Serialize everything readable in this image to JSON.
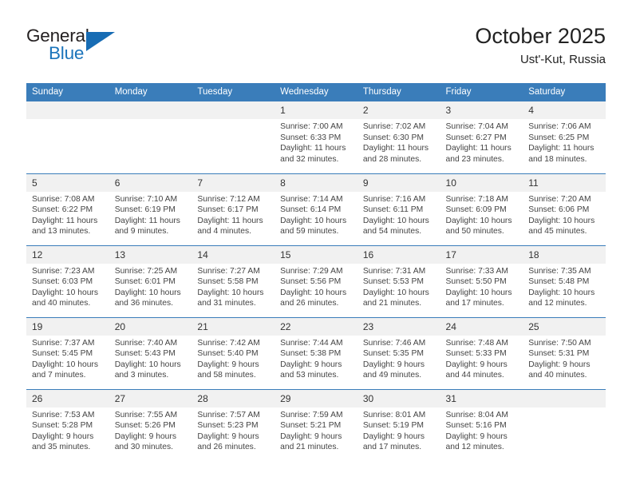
{
  "brand": {
    "word_one": "General",
    "word_two": "Blue",
    "triangle_icon": "blue-triangle-logo-mark",
    "accent_color": "#176cb4"
  },
  "header": {
    "title": "October 2025",
    "subtitle": "Ust'-Kut, Russia"
  },
  "calendar": {
    "header_color": "#3a7dba",
    "daynum_band_color": "#f1f1f1",
    "weekday_headers": [
      "Sunday",
      "Monday",
      "Tuesday",
      "Wednesday",
      "Thursday",
      "Friday",
      "Saturday"
    ],
    "labels": {
      "sunrise": "Sunrise:",
      "sunset": "Sunset:",
      "daylight": "Daylight:"
    },
    "weeks": [
      [
        {
          "day": "",
          "empty": true
        },
        {
          "day": "",
          "empty": true
        },
        {
          "day": "",
          "empty": true
        },
        {
          "day": "1",
          "sunrise": "Sunrise: 7:00 AM",
          "sunset": "Sunset: 6:33 PM",
          "daylight_1": "Daylight: 11 hours",
          "daylight_2": "and 32 minutes."
        },
        {
          "day": "2",
          "sunrise": "Sunrise: 7:02 AM",
          "sunset": "Sunset: 6:30 PM",
          "daylight_1": "Daylight: 11 hours",
          "daylight_2": "and 28 minutes."
        },
        {
          "day": "3",
          "sunrise": "Sunrise: 7:04 AM",
          "sunset": "Sunset: 6:27 PM",
          "daylight_1": "Daylight: 11 hours",
          "daylight_2": "and 23 minutes."
        },
        {
          "day": "4",
          "sunrise": "Sunrise: 7:06 AM",
          "sunset": "Sunset: 6:25 PM",
          "daylight_1": "Daylight: 11 hours",
          "daylight_2": "and 18 minutes."
        }
      ],
      [
        {
          "day": "5",
          "sunrise": "Sunrise: 7:08 AM",
          "sunset": "Sunset: 6:22 PM",
          "daylight_1": "Daylight: 11 hours",
          "daylight_2": "and 13 minutes."
        },
        {
          "day": "6",
          "sunrise": "Sunrise: 7:10 AM",
          "sunset": "Sunset: 6:19 PM",
          "daylight_1": "Daylight: 11 hours",
          "daylight_2": "and 9 minutes."
        },
        {
          "day": "7",
          "sunrise": "Sunrise: 7:12 AM",
          "sunset": "Sunset: 6:17 PM",
          "daylight_1": "Daylight: 11 hours",
          "daylight_2": "and 4 minutes."
        },
        {
          "day": "8",
          "sunrise": "Sunrise: 7:14 AM",
          "sunset": "Sunset: 6:14 PM",
          "daylight_1": "Daylight: 10 hours",
          "daylight_2": "and 59 minutes."
        },
        {
          "day": "9",
          "sunrise": "Sunrise: 7:16 AM",
          "sunset": "Sunset: 6:11 PM",
          "daylight_1": "Daylight: 10 hours",
          "daylight_2": "and 54 minutes."
        },
        {
          "day": "10",
          "sunrise": "Sunrise: 7:18 AM",
          "sunset": "Sunset: 6:09 PM",
          "daylight_1": "Daylight: 10 hours",
          "daylight_2": "and 50 minutes."
        },
        {
          "day": "11",
          "sunrise": "Sunrise: 7:20 AM",
          "sunset": "Sunset: 6:06 PM",
          "daylight_1": "Daylight: 10 hours",
          "daylight_2": "and 45 minutes."
        }
      ],
      [
        {
          "day": "12",
          "sunrise": "Sunrise: 7:23 AM",
          "sunset": "Sunset: 6:03 PM",
          "daylight_1": "Daylight: 10 hours",
          "daylight_2": "and 40 minutes."
        },
        {
          "day": "13",
          "sunrise": "Sunrise: 7:25 AM",
          "sunset": "Sunset: 6:01 PM",
          "daylight_1": "Daylight: 10 hours",
          "daylight_2": "and 36 minutes."
        },
        {
          "day": "14",
          "sunrise": "Sunrise: 7:27 AM",
          "sunset": "Sunset: 5:58 PM",
          "daylight_1": "Daylight: 10 hours",
          "daylight_2": "and 31 minutes."
        },
        {
          "day": "15",
          "sunrise": "Sunrise: 7:29 AM",
          "sunset": "Sunset: 5:56 PM",
          "daylight_1": "Daylight: 10 hours",
          "daylight_2": "and 26 minutes."
        },
        {
          "day": "16",
          "sunrise": "Sunrise: 7:31 AM",
          "sunset": "Sunset: 5:53 PM",
          "daylight_1": "Daylight: 10 hours",
          "daylight_2": "and 21 minutes."
        },
        {
          "day": "17",
          "sunrise": "Sunrise: 7:33 AM",
          "sunset": "Sunset: 5:50 PM",
          "daylight_1": "Daylight: 10 hours",
          "daylight_2": "and 17 minutes."
        },
        {
          "day": "18",
          "sunrise": "Sunrise: 7:35 AM",
          "sunset": "Sunset: 5:48 PM",
          "daylight_1": "Daylight: 10 hours",
          "daylight_2": "and 12 minutes."
        }
      ],
      [
        {
          "day": "19",
          "sunrise": "Sunrise: 7:37 AM",
          "sunset": "Sunset: 5:45 PM",
          "daylight_1": "Daylight: 10 hours",
          "daylight_2": "and 7 minutes."
        },
        {
          "day": "20",
          "sunrise": "Sunrise: 7:40 AM",
          "sunset": "Sunset: 5:43 PM",
          "daylight_1": "Daylight: 10 hours",
          "daylight_2": "and 3 minutes."
        },
        {
          "day": "21",
          "sunrise": "Sunrise: 7:42 AM",
          "sunset": "Sunset: 5:40 PM",
          "daylight_1": "Daylight: 9 hours",
          "daylight_2": "and 58 minutes."
        },
        {
          "day": "22",
          "sunrise": "Sunrise: 7:44 AM",
          "sunset": "Sunset: 5:38 PM",
          "daylight_1": "Daylight: 9 hours",
          "daylight_2": "and 53 minutes."
        },
        {
          "day": "23",
          "sunrise": "Sunrise: 7:46 AM",
          "sunset": "Sunset: 5:35 PM",
          "daylight_1": "Daylight: 9 hours",
          "daylight_2": "and 49 minutes."
        },
        {
          "day": "24",
          "sunrise": "Sunrise: 7:48 AM",
          "sunset": "Sunset: 5:33 PM",
          "daylight_1": "Daylight: 9 hours",
          "daylight_2": "and 44 minutes."
        },
        {
          "day": "25",
          "sunrise": "Sunrise: 7:50 AM",
          "sunset": "Sunset: 5:31 PM",
          "daylight_1": "Daylight: 9 hours",
          "daylight_2": "and 40 minutes."
        }
      ],
      [
        {
          "day": "26",
          "sunrise": "Sunrise: 7:53 AM",
          "sunset": "Sunset: 5:28 PM",
          "daylight_1": "Daylight: 9 hours",
          "daylight_2": "and 35 minutes."
        },
        {
          "day": "27",
          "sunrise": "Sunrise: 7:55 AM",
          "sunset": "Sunset: 5:26 PM",
          "daylight_1": "Daylight: 9 hours",
          "daylight_2": "and 30 minutes."
        },
        {
          "day": "28",
          "sunrise": "Sunrise: 7:57 AM",
          "sunset": "Sunset: 5:23 PM",
          "daylight_1": "Daylight: 9 hours",
          "daylight_2": "and 26 minutes."
        },
        {
          "day": "29",
          "sunrise": "Sunrise: 7:59 AM",
          "sunset": "Sunset: 5:21 PM",
          "daylight_1": "Daylight: 9 hours",
          "daylight_2": "and 21 minutes."
        },
        {
          "day": "30",
          "sunrise": "Sunrise: 8:01 AM",
          "sunset": "Sunset: 5:19 PM",
          "daylight_1": "Daylight: 9 hours",
          "daylight_2": "and 17 minutes."
        },
        {
          "day": "31",
          "sunrise": "Sunrise: 8:04 AM",
          "sunset": "Sunset: 5:16 PM",
          "daylight_1": "Daylight: 9 hours",
          "daylight_2": "and 12 minutes."
        },
        {
          "day": "",
          "empty": true
        }
      ]
    ]
  }
}
